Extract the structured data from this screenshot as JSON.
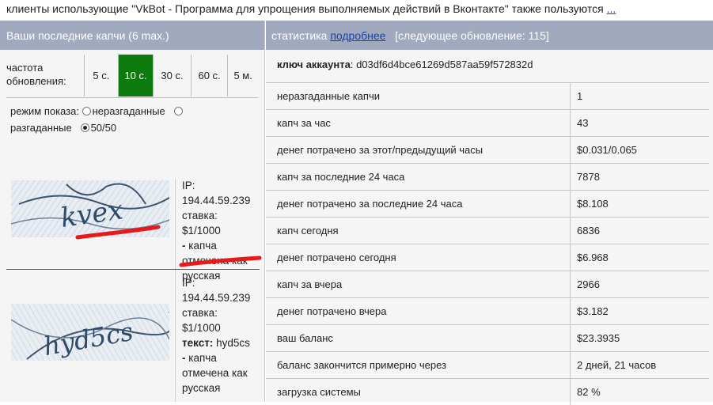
{
  "top": {
    "text": "клиенты использующие \"VkBot - Программа для упрощения выполняемых действий в Вконтакте\" также пользуются",
    "more_link": "..."
  },
  "left": {
    "title": "Ваши последние капчи (6 max.)",
    "freq_label": "частота обновления:",
    "freq_options": [
      "5 с.",
      "10 с.",
      "30 с.",
      "60 с.",
      "5 м."
    ],
    "freq_selected_index": 1,
    "mode_label": "режим показа:",
    "mode_options": [
      "неразгаданные",
      "разгаданные",
      "50/50"
    ],
    "mode_selected": "50/50",
    "captchas": [
      {
        "ip_label": "IP:",
        "ip": "194.44.59.239",
        "rate_label": "ставка:",
        "rate": "$1/1000",
        "text_label": "",
        "text": "",
        "note_dash": "-",
        "note": "капча отмечена как русская"
      },
      {
        "ip_label": "IP:",
        "ip": "194.44.59.239",
        "rate_label": "ставка:",
        "rate": "$1/1000",
        "text_label": "текст:",
        "text": "hyd5cs",
        "note_dash": "-",
        "note": "капча отмечена как русская"
      }
    ]
  },
  "right": {
    "title": "статистика",
    "details_link": "подробнее",
    "next_update": "[следующее обновление: 115]",
    "account_key_label": "ключ аккаунта",
    "account_key": "d03df6d4bce61269d587aa59f572832d",
    "stats": [
      {
        "name": "неразгаданные капчи",
        "value": "1"
      },
      {
        "name": "капч за час",
        "value": "43"
      },
      {
        "name": "денег потрачено за этот/предыдущий часы",
        "value": "$0.031/0.065"
      },
      {
        "name": "капч за последние 24 часа",
        "value": "7878"
      },
      {
        "name": "денег потрачено за последние 24 часа",
        "value": "$8.108"
      },
      {
        "name": "капч сегодня",
        "value": "6836"
      },
      {
        "name": "денег потрачено сегодня",
        "value": "$6.968"
      },
      {
        "name": "капч за вчера",
        "value": "2966"
      },
      {
        "name": "денег потрачено вчера",
        "value": "$3.182"
      },
      {
        "name": "ваш баланс",
        "value": "$23.3935"
      },
      {
        "name": "баланс закончится примерно через",
        "value": "2 дней, 21 часов"
      },
      {
        "name": "загрузка системы",
        "value": "82 %"
      }
    ]
  },
  "colors": {
    "header_bg": "#a0a9bd",
    "selected_freq": "#0c7a0c",
    "annotation_red": "#e8191b",
    "link": "#1a3ea8"
  }
}
